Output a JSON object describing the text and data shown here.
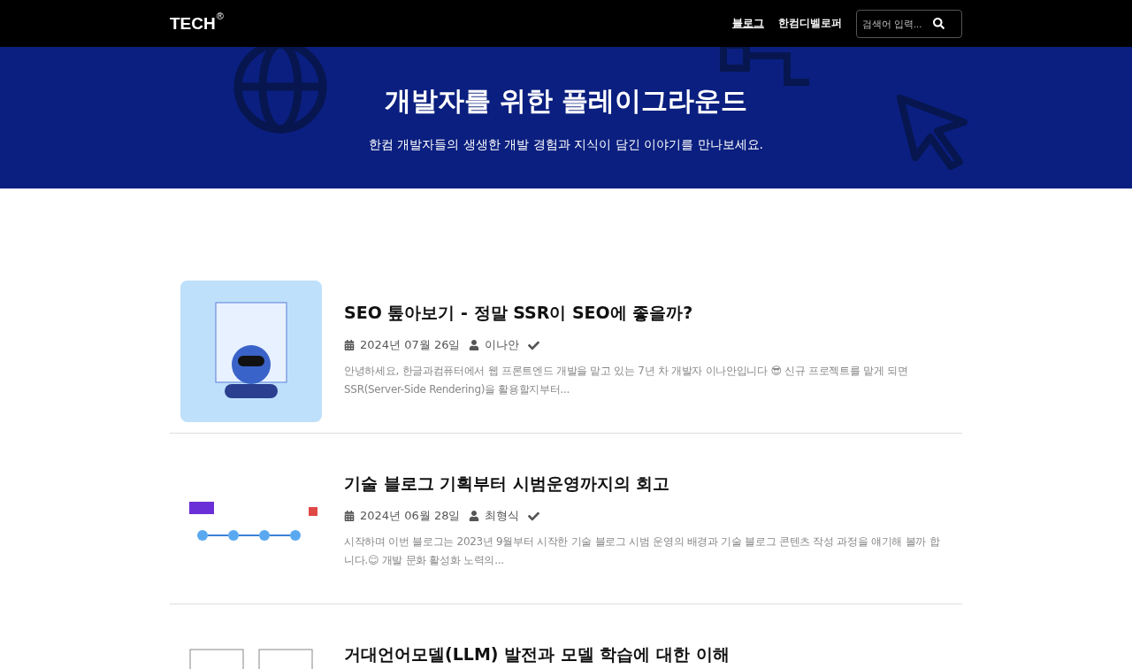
{
  "header": {
    "logo": "TECH",
    "logo_mark": "®",
    "nav": [
      {
        "label": "블로그",
        "selected": true
      },
      {
        "label": "한컴디벨로퍼",
        "selected": false
      }
    ],
    "search": {
      "placeholder": "검색어 입력..."
    }
  },
  "hero": {
    "title": "개발자를 위한 플레이그라운드",
    "subtitle": "한컴 개발자들의 생생한 개발 경험과 지식이 담긴 이야기를 만나보세요."
  },
  "posts": [
    {
      "title": "SEO 톺아보기 - 정말 SSR이 SEO에 좋을까?",
      "date": "2024년 07월 26일",
      "author": "이나안",
      "excerpt": "안녕하세요, 한글과컴퓨터에서 웹 프론트엔드 개발을 맡고 있는 7년 차 개발자 이나안입니다 😎 신규 프로젝트를 맡게 되면 SSR(Server-Side Rendering)을 활용할지부터..."
    },
    {
      "title": "기술 블로그 기획부터 시범운영까지의 회고",
      "date": "2024년 06월 28일",
      "author": "최형식",
      "excerpt": "시작하며 이번 블로그는 2023년 9월부터 시작한 기술 블로그 시범 운영의 배경과 기술 블로그 콘텐츠 작성 과정을 얘기해 볼까 합니다.😊 개발 문화 활성화 노력의..."
    },
    {
      "title": "거대언어모델(LLM) 발전과 모델 학습에 대한 이해"
    }
  ]
}
